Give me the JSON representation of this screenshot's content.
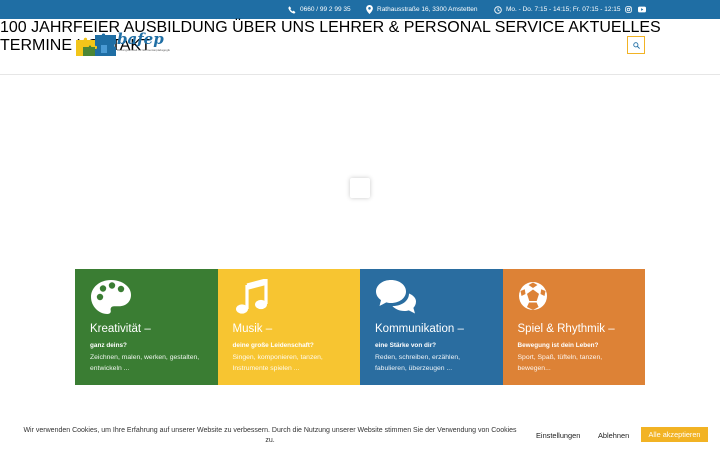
{
  "topbar": {
    "phone_icon": "phone-icon",
    "phone": "0660 / 99 2 99 35",
    "address_icon": "map-marker-icon",
    "address": "Rathausstraße 16, 3300 Amstetten",
    "hours_icon": "clock-icon",
    "hours": "Mo. - Do. 7:15 - 14:15; Fr. 07:15 - 12:15",
    "social": [
      "instagram-icon",
      "youtube-icon"
    ]
  },
  "logo": {
    "word": "bafep",
    "tagline": "Bildungsanstalt für Elementarpädagogik"
  },
  "nav": {
    "items": [
      "100 JAHRFEIER",
      "AUSBILDUNG",
      "ÜBER UNS",
      "LEHRER & PERSONAL",
      "SERVICE",
      "AKTUELLES",
      "TERMINE",
      "KONTAKT"
    ],
    "search_icon": "search-icon"
  },
  "cards": [
    {
      "icon": "palette-icon",
      "title": "Kreativität –",
      "subtitle": "ganz deins?",
      "desc": "Zeichnen, malen, werken, gestalten, entwickeln ...",
      "color": "#3a7d33"
    },
    {
      "icon": "music-note-icon",
      "title": "Musik –",
      "subtitle": "deine große Leidenschaft?",
      "desc": "Singen, komponieren, tanzen, Instrumente spielen ...",
      "color": "#f7c531"
    },
    {
      "icon": "chat-bubbles-icon",
      "title": "Kommunikation –",
      "subtitle": "eine Stärke von dir?",
      "desc": "Reden, schreiben, erzählen, fabulieren, überzeugen ...",
      "color": "#2a6da0"
    },
    {
      "icon": "soccer-ball-icon",
      "title": "Spiel & Rhythmik –",
      "subtitle": "Bewegung ist dein Leben?",
      "desc": "Sport, Spaß, tüfteln, tanzen, bewegen...",
      "color": "#dd8236"
    }
  ],
  "cookie": {
    "text": "Wir verwenden Cookies, um Ihre Erfahrung auf unserer Website zu verbessern. Durch die Nutzung unserer Website stimmen Sie der Verwendung von Cookies zu.",
    "settings": "Einstellungen",
    "decline": "Ablehnen",
    "accept": "Alle akzeptieren"
  },
  "colors": {
    "brand_blue": "#1f6ea4",
    "accent_yellow": "#f2b324"
  }
}
